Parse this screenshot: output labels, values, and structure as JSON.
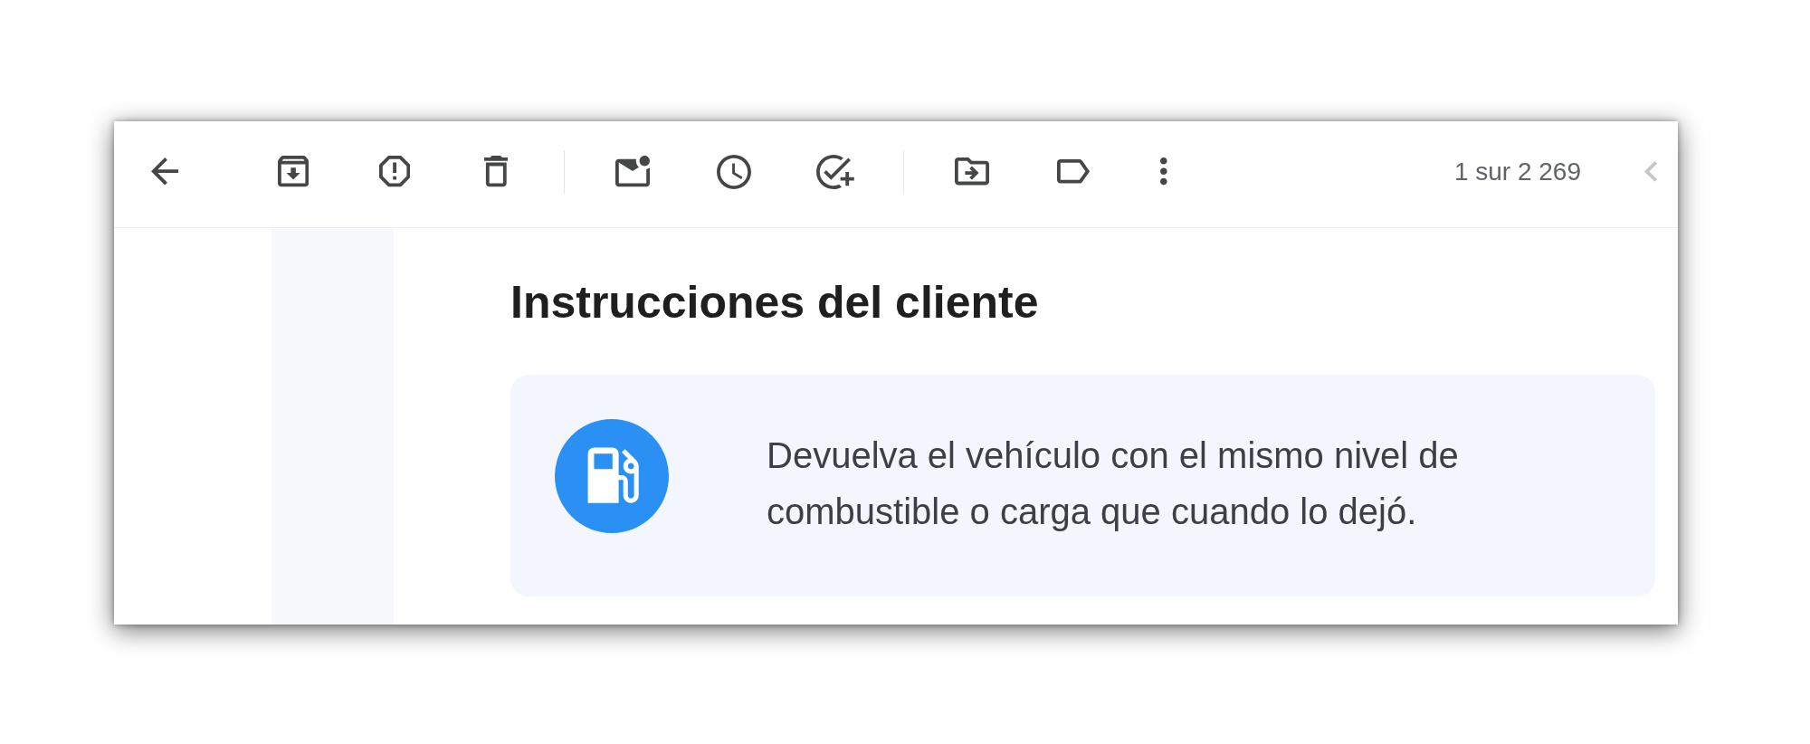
{
  "toolbar": {
    "counter": "1 sur 2 269",
    "newer_button": {
      "disabled": true
    }
  },
  "message": {
    "heading": "Instrucciones del cliente",
    "instruction_card": {
      "text": "Devuelva el vehículo con el mismo nivel de combustible o carga que cuando lo dejó."
    }
  }
}
